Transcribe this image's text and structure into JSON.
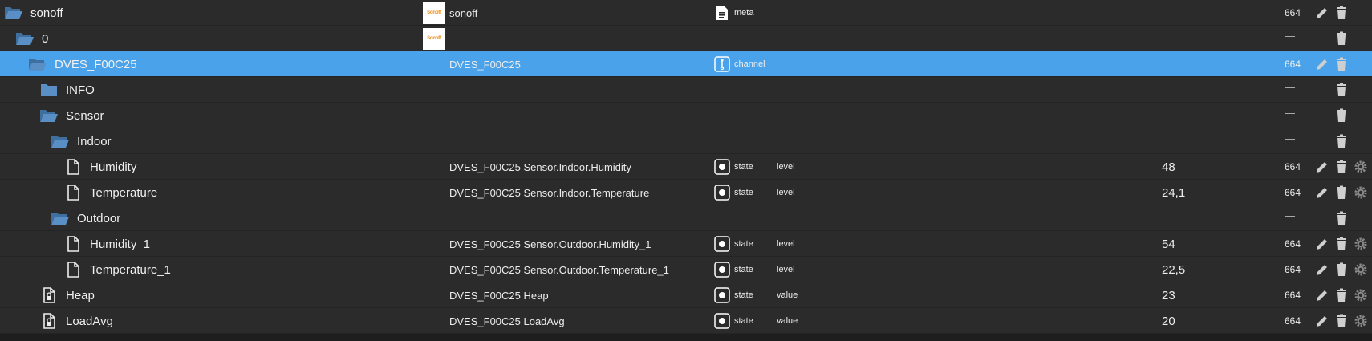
{
  "rows": [
    {
      "level": 0,
      "icon": "folder-open",
      "name": "sonoff",
      "logo": "Sonoff",
      "objname": "sonoff",
      "type_icon": "meta",
      "type": "meta",
      "role": "",
      "value": "",
      "acl": "664",
      "actions": [
        "edit",
        "delete"
      ]
    },
    {
      "level": 1,
      "icon": "folder-open",
      "name": "0",
      "logo": "Sonoff",
      "objname": "",
      "type_icon": "",
      "type": "",
      "role": "",
      "value": "",
      "acl": "—",
      "actions": [
        "delete"
      ]
    },
    {
      "level": 2,
      "icon": "folder-open",
      "name": "DVES_F00C25",
      "selected": true,
      "logo": "",
      "objname": "DVES_F00C25",
      "type_icon": "channel",
      "type": "channel",
      "role": "",
      "value": "",
      "acl": "664",
      "actions": [
        "edit",
        "delete"
      ]
    },
    {
      "level": 3,
      "icon": "folder",
      "name": "INFO",
      "logo": "",
      "objname": "",
      "type_icon": "",
      "type": "",
      "role": "",
      "value": "",
      "acl": "—",
      "actions": [
        "delete"
      ]
    },
    {
      "level": 3,
      "icon": "folder-open",
      "name": "Sensor",
      "logo": "",
      "objname": "",
      "type_icon": "",
      "type": "",
      "role": "",
      "value": "",
      "acl": "—",
      "actions": [
        "delete"
      ]
    },
    {
      "level": 4,
      "icon": "folder-open",
      "name": "Indoor",
      "logo": "",
      "objname": "",
      "type_icon": "",
      "type": "",
      "role": "",
      "value": "",
      "acl": "—",
      "actions": [
        "delete"
      ]
    },
    {
      "level": 5,
      "icon": "file",
      "name": "Humidity",
      "logo": "",
      "objname": "DVES_F00C25 Sensor.Indoor.Humidity",
      "type_icon": "state",
      "type": "state",
      "role": "level",
      "value": "48",
      "acl": "664",
      "actions": [
        "edit",
        "delete",
        "settings"
      ]
    },
    {
      "level": 5,
      "icon": "file",
      "name": "Temperature",
      "logo": "",
      "objname": "DVES_F00C25 Sensor.Indoor.Temperature",
      "type_icon": "state",
      "type": "state",
      "role": "level",
      "value": "24,1",
      "acl": "664",
      "actions": [
        "edit",
        "delete",
        "settings"
      ]
    },
    {
      "level": 4,
      "icon": "folder-open",
      "name": "Outdoor",
      "logo": "",
      "objname": "",
      "type_icon": "",
      "type": "",
      "role": "",
      "value": "",
      "acl": "—",
      "actions": [
        "delete"
      ]
    },
    {
      "level": 5,
      "icon": "file",
      "name": "Humidity_1",
      "logo": "",
      "objname": "DVES_F00C25 Sensor.Outdoor.Humidity_1",
      "type_icon": "state",
      "type": "state",
      "role": "level",
      "value": "54",
      "acl": "664",
      "actions": [
        "edit",
        "delete",
        "settings"
      ]
    },
    {
      "level": 5,
      "icon": "file",
      "name": "Temperature_1",
      "logo": "",
      "objname": "DVES_F00C25 Sensor.Outdoor.Temperature_1",
      "type_icon": "state",
      "type": "state",
      "role": "level",
      "value": "22,5",
      "acl": "664",
      "actions": [
        "edit",
        "delete",
        "settings"
      ]
    },
    {
      "level": 3,
      "icon": "file-lock",
      "name": "Heap",
      "logo": "",
      "objname": "DVES_F00C25 Heap",
      "type_icon": "state",
      "type": "state",
      "role": "value",
      "value": "23",
      "acl": "664",
      "actions": [
        "edit",
        "delete",
        "settings"
      ]
    },
    {
      "level": 3,
      "icon": "file-lock",
      "name": "LoadAvg",
      "logo": "",
      "objname": "DVES_F00C25 LoadAvg",
      "type_icon": "state",
      "type": "state",
      "role": "value",
      "value": "20",
      "acl": "664",
      "actions": [
        "edit",
        "delete",
        "settings"
      ]
    }
  ]
}
